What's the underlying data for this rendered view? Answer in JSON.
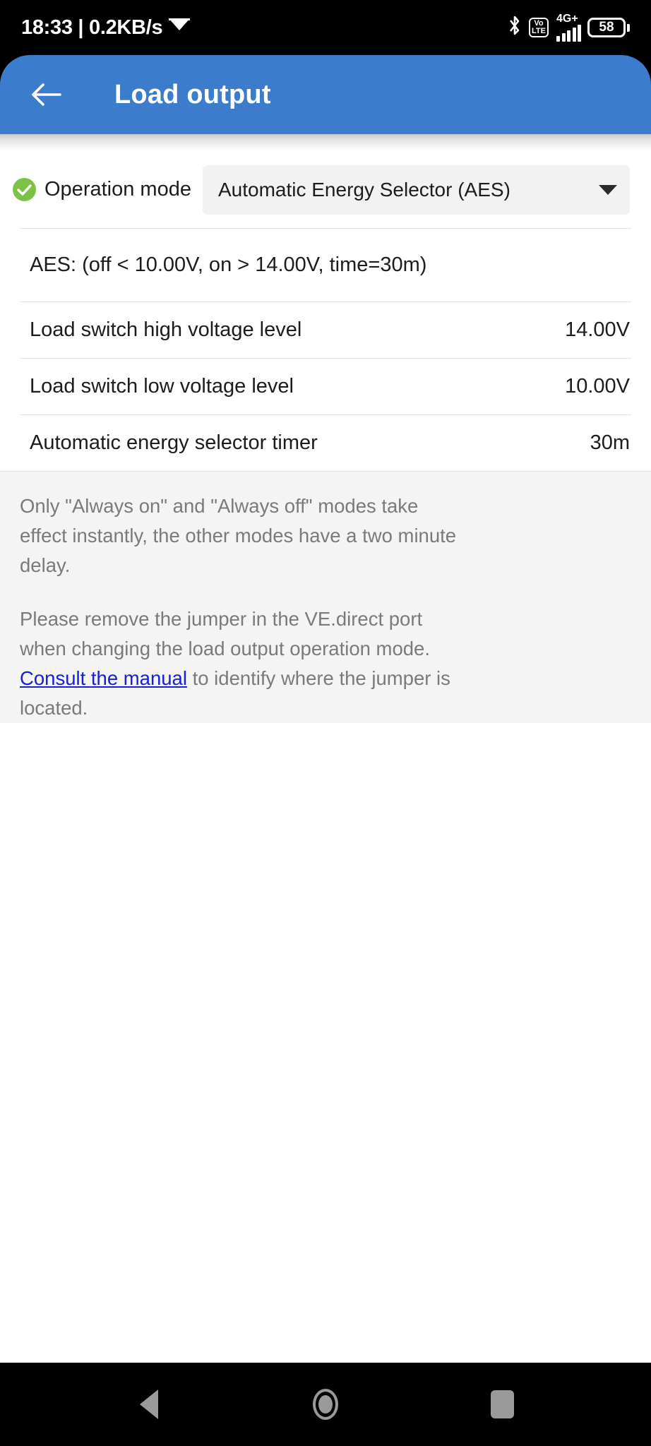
{
  "status_bar": {
    "clock": "18:33 | 0.2KB/s",
    "data_icon": "envelope-icon",
    "bluetooth_icon": "bluetooth-icon",
    "volte_top": "Vo",
    "volte_bottom": "LTE",
    "network_label": "4G+",
    "signal_icon": "signal-bars-icon",
    "battery_level": "58"
  },
  "app_bar": {
    "back_icon": "back-arrow-icon",
    "title": "Load output",
    "accent_color": "#3b7dcc"
  },
  "settings": {
    "operation_mode": {
      "status_icon": "green-check-icon",
      "status_color": "#7dc246",
      "label": "Operation mode",
      "selected_value": "Automatic Energy Selector (AES)",
      "caret_icon": "chevron-down-icon"
    },
    "summary": "AES: (off < 10.00V, on > 14.00V, time=30m)",
    "rows": [
      {
        "label": "Load switch high voltage level",
        "value": "14.00V"
      },
      {
        "label": "Load switch low voltage level",
        "value": "10.00V"
      },
      {
        "label": "Automatic energy selector timer",
        "value": "30m"
      }
    ]
  },
  "notes": {
    "paragraph1": "Only \"Always on\" and \"Always off\" modes take effect instantly, the other modes have a two minute delay.",
    "paragraph2_before": "Please remove the jumper in the VE.direct port when changing the load output operation mode.",
    "link_text": "Consult the manual",
    "paragraph2_after": " to identify where the jumper is located.",
    "link_color": "#1521d6"
  },
  "nav_bar": {
    "back": "nav-back-icon",
    "home": "nav-home-icon",
    "recents": "nav-recents-icon"
  }
}
